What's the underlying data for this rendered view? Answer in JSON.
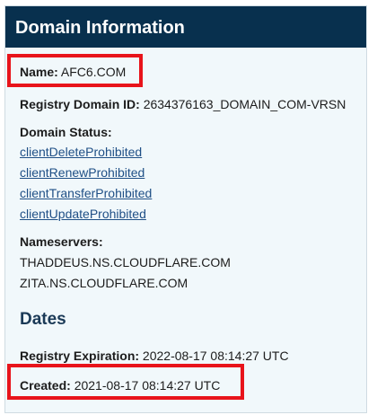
{
  "card": {
    "title": "Domain Information"
  },
  "fields": {
    "name_label": "Name:",
    "name_value": "AFC6.COM",
    "registry_id_label": "Registry Domain ID:",
    "registry_id_value": "2634376163_DOMAIN_COM-VRSN",
    "status_label": "Domain Status:",
    "statuses": [
      "clientDeleteProhibited",
      "clientRenewProhibited",
      "clientTransferProhibited",
      "clientUpdateProhibited"
    ],
    "nameservers_label": "Nameservers:",
    "nameservers": [
      "THADDEUS.NS.CLOUDFLARE.COM",
      "ZITA.NS.CLOUDFLARE.COM"
    ]
  },
  "dates": {
    "title": "Dates",
    "expiration_label": "Registry Expiration:",
    "expiration_value": "2022-08-17 08:14:27 UTC",
    "created_label": "Created:",
    "created_value": "2021-08-17 08:14:27 UTC"
  },
  "colors": {
    "header_bg": "#08304e",
    "card_bg": "#f1f8fb",
    "link": "#1f4f86",
    "highlight": "#e8141b"
  }
}
